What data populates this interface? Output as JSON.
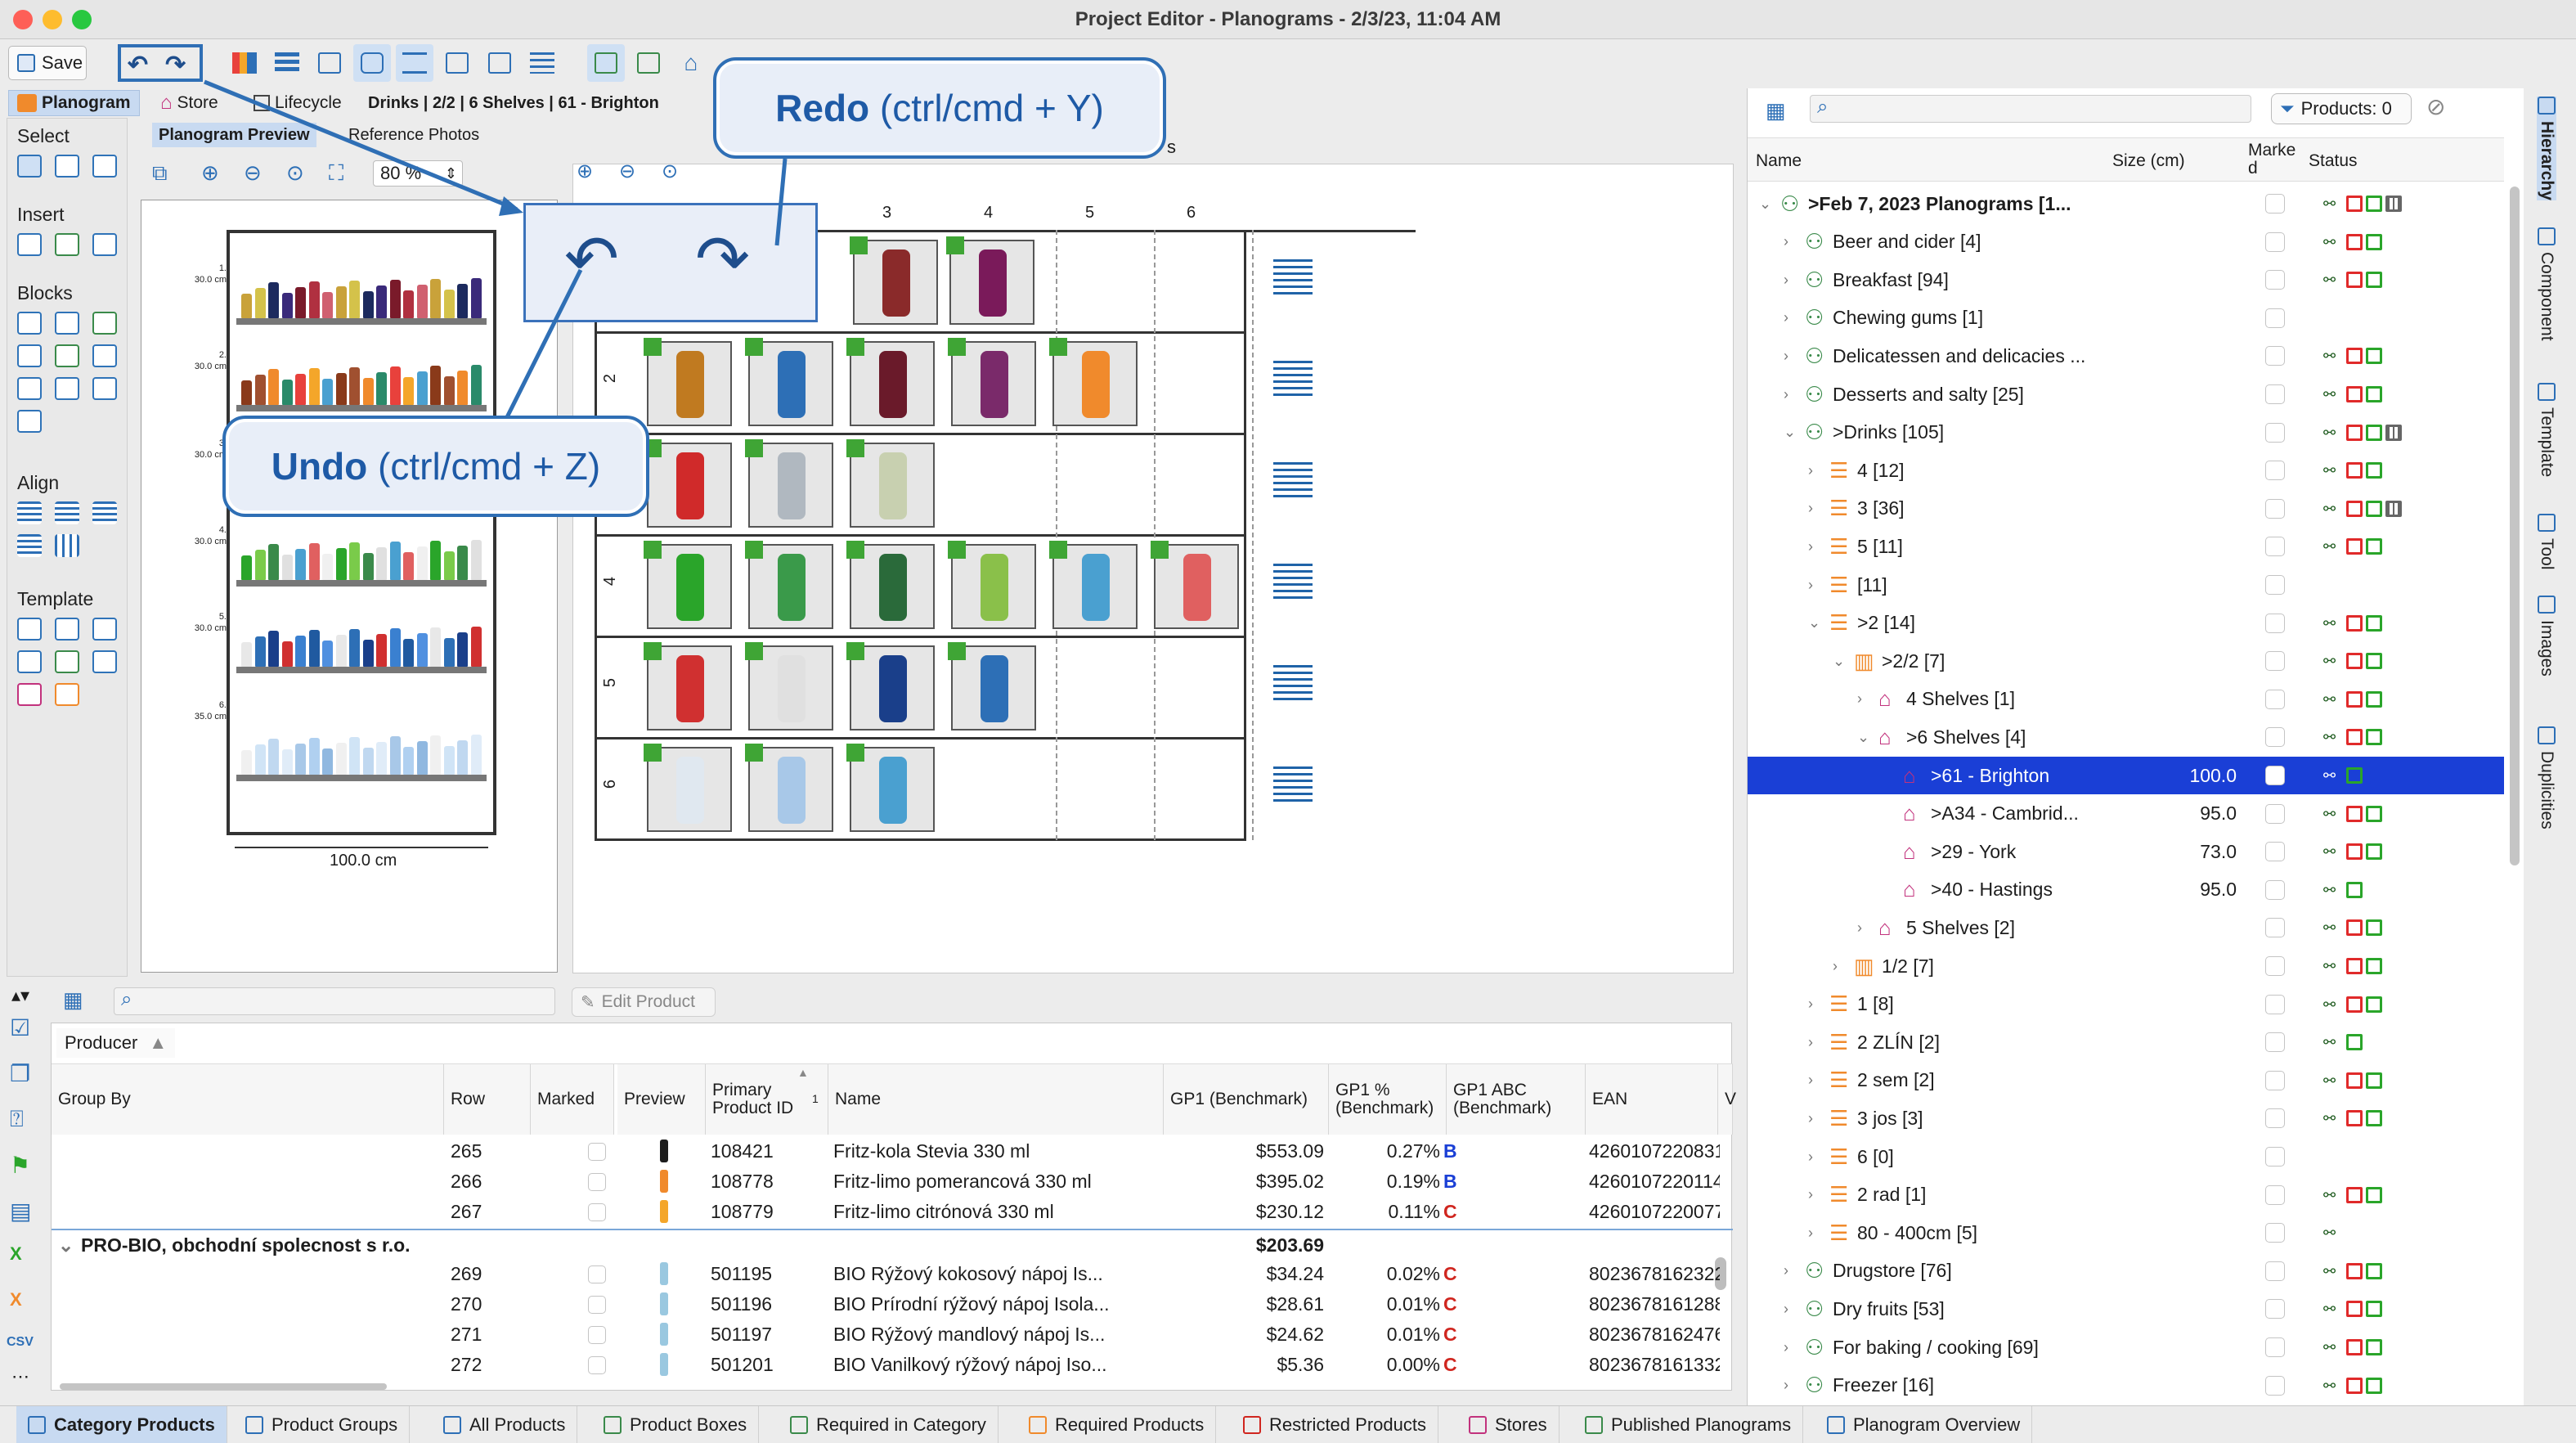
{
  "window": {
    "title": "Project Editor - Planograms - 2/3/23, 11:04 AM"
  },
  "toolbar": {
    "save_label": "Save"
  },
  "view_tabs": {
    "planogram": "Planogram",
    "store": "Store",
    "lifecycle": "Lifecycle",
    "breadcrumb": "Drinks | 2/2 | 6 Shelves | 61 - Brighton"
  },
  "preview_tabs": {
    "planogram_preview": "Planogram Preview",
    "reference_photos": "Reference Photos",
    "zoom": "80 %"
  },
  "palette": {
    "select": "Select",
    "insert": "Insert",
    "blocks": "Blocks",
    "align": "Align",
    "template": "Template"
  },
  "preview": {
    "shelf_labels": [
      {
        "num": "1.",
        "size": "30.0 cm"
      },
      {
        "num": "2.",
        "size": "30.0 cm"
      },
      {
        "num": "3.",
        "size": "30.0 cm"
      },
      {
        "num": "4.",
        "size": "30.0 cm"
      },
      {
        "num": "5.",
        "size": "30.0 cm"
      },
      {
        "num": "6.",
        "size": "35.0 cm"
      }
    ],
    "width_label": "100.0 cm"
  },
  "planogram": {
    "col_headers": [
      "3",
      "4",
      "5",
      "6"
    ],
    "row_labels": [
      "2",
      "3",
      "4",
      "5",
      "6"
    ],
    "side_text": "s"
  },
  "callouts": {
    "redo": {
      "bold": "Redo",
      "rest": " (ctrl/cmd + Y)"
    },
    "undo": {
      "bold": "Undo",
      "rest": " (ctrl/cmd + Z)"
    }
  },
  "hierarchy": {
    "products_button": "Products: 0",
    "columns": {
      "name": "Name",
      "size": "Size (cm)",
      "marked": "Marke d",
      "status": "Status"
    },
    "rows": [
      {
        "indent": 0,
        "arrow": "v",
        "icon": "tree-icon",
        "label": ">Feb 7, 2023 Planograms [1...",
        "size": "",
        "bold": true,
        "status": [
          "net",
          "red",
          "green",
          "grid"
        ]
      },
      {
        "indent": 1,
        "arrow": ">",
        "icon": "tree-icon",
        "label": "Beer and cider [4]",
        "size": "",
        "status": [
          "net",
          "red",
          "green"
        ]
      },
      {
        "indent": 1,
        "arrow": ">",
        "icon": "tree-icon",
        "label": "Breakfast [94]",
        "size": "",
        "status": [
          "net",
          "red",
          "green"
        ]
      },
      {
        "indent": 1,
        "arrow": ">",
        "icon": "tree-icon",
        "label": "Chewing gums [1]",
        "size": "",
        "status": []
      },
      {
        "indent": 1,
        "arrow": ">",
        "icon": "tree-icon",
        "label": "Delicatessen and delicacies ...",
        "size": "",
        "status": [
          "net",
          "red",
          "green"
        ]
      },
      {
        "indent": 1,
        "arrow": ">",
        "icon": "tree-icon",
        "label": "Desserts and salty [25]",
        "size": "",
        "status": [
          "net",
          "red",
          "green"
        ]
      },
      {
        "indent": 1,
        "arrow": "v",
        "icon": "tree-icon",
        "label": ">Drinks [105]",
        "size": "",
        "status": [
          "net",
          "red",
          "green",
          "grid"
        ]
      },
      {
        "indent": 2,
        "arrow": ">",
        "icon": "shelf-icon",
        "label": "4 [12]",
        "size": "",
        "status": [
          "net",
          "red",
          "green"
        ]
      },
      {
        "indent": 2,
        "arrow": ">",
        "icon": "shelf-icon",
        "label": "3 [36]",
        "size": "",
        "status": [
          "net",
          "red",
          "green",
          "grid"
        ]
      },
      {
        "indent": 2,
        "arrow": ">",
        "icon": "shelf-icon",
        "label": "5 [11]",
        "size": "",
        "status": [
          "net",
          "red",
          "green"
        ]
      },
      {
        "indent": 2,
        "arrow": ">",
        "icon": "shelf-icon",
        "label": "[11]",
        "size": "",
        "status": []
      },
      {
        "indent": 2,
        "arrow": "v",
        "icon": "shelf-icon",
        "label": ">2 [14]",
        "size": "",
        "status": [
          "net",
          "red",
          "green"
        ]
      },
      {
        "indent": 3,
        "arrow": "v",
        "icon": "store-icon",
        "label": ">2/2 [7]",
        "size": "",
        "status": [
          "net",
          "red",
          "green"
        ]
      },
      {
        "indent": 4,
        "arrow": ">",
        "icon": "house-icon",
        "label": "4 Shelves [1]",
        "size": "",
        "status": [
          "net",
          "red",
          "green"
        ]
      },
      {
        "indent": 4,
        "arrow": "v",
        "icon": "house-icon",
        "label": ">6 Shelves [4]",
        "size": "",
        "status": [
          "net",
          "red",
          "green"
        ]
      },
      {
        "indent": 5,
        "arrow": "",
        "icon": "house-icon",
        "label": ">61 - Brighton",
        "size": "100.0",
        "selected": true,
        "status": [
          "net",
          "green"
        ]
      },
      {
        "indent": 5,
        "arrow": "",
        "icon": "house-icon",
        "label": ">A34 - Cambrid...",
        "size": "95.0",
        "status": [
          "net",
          "red",
          "green"
        ]
      },
      {
        "indent": 5,
        "arrow": "",
        "icon": "house-icon",
        "label": ">29 - York",
        "size": "73.0",
        "status": [
          "net",
          "red",
          "green"
        ]
      },
      {
        "indent": 5,
        "arrow": "",
        "icon": "house-icon",
        "label": ">40 - Hastings",
        "size": "95.0",
        "status": [
          "net",
          "green"
        ]
      },
      {
        "indent": 4,
        "arrow": ">",
        "icon": "house-icon",
        "label": "5 Shelves [2]",
        "size": "",
        "status": [
          "net",
          "red",
          "green"
        ]
      },
      {
        "indent": 3,
        "arrow": ">",
        "icon": "store-icon",
        "label": "1/2 [7]",
        "size": "",
        "status": [
          "net",
          "red",
          "green"
        ]
      },
      {
        "indent": 2,
        "arrow": ">",
        "icon": "shelf-icon",
        "label": "1 [8]",
        "size": "",
        "status": [
          "net",
          "red",
          "green"
        ]
      },
      {
        "indent": 2,
        "arrow": ">",
        "icon": "shelf-icon",
        "label": "2 ZLÍN [2]",
        "size": "",
        "status": [
          "net",
          "green"
        ]
      },
      {
        "indent": 2,
        "arrow": ">",
        "icon": "shelf-icon",
        "label": "2 sem [2]",
        "size": "",
        "status": [
          "net",
          "red",
          "green"
        ]
      },
      {
        "indent": 2,
        "arrow": ">",
        "icon": "shelf-icon",
        "label": "3 jos [3]",
        "size": "",
        "status": [
          "net",
          "red",
          "green"
        ]
      },
      {
        "indent": 2,
        "arrow": ">",
        "icon": "shelf-icon",
        "label": "6 [0]",
        "size": "",
        "status": []
      },
      {
        "indent": 2,
        "arrow": ">",
        "icon": "shelf-icon",
        "label": "2 rad [1]",
        "size": "",
        "status": [
          "net",
          "red",
          "green"
        ]
      },
      {
        "indent": 2,
        "arrow": ">",
        "icon": "shelf-icon",
        "label": "80 - 400cm [5]",
        "size": "",
        "status": [
          "net"
        ]
      },
      {
        "indent": 1,
        "arrow": ">",
        "icon": "tree-icon",
        "label": "Drugstore [76]",
        "size": "",
        "status": [
          "net",
          "red",
          "green"
        ]
      },
      {
        "indent": 1,
        "arrow": ">",
        "icon": "tree-icon",
        "label": "Dry fruits [53]",
        "size": "",
        "status": [
          "net",
          "red",
          "green"
        ]
      },
      {
        "indent": 1,
        "arrow": ">",
        "icon": "tree-icon",
        "label": "For baking / cooking [69]",
        "size": "",
        "status": [
          "net",
          "red",
          "green"
        ]
      },
      {
        "indent": 1,
        "arrow": ">",
        "icon": "tree-icon",
        "label": "Freezer [16]",
        "size": "",
        "status": [
          "net",
          "red",
          "green"
        ]
      }
    ]
  },
  "side_tabs": [
    "Hierarchy",
    "Component",
    "Template",
    "Tool",
    "Images",
    "Duplicities"
  ],
  "product_table": {
    "edit_button": "Edit Product",
    "group_field": "Producer",
    "headers": [
      "Group By",
      "Row",
      "Marked",
      "Preview",
      "Primary Product ID",
      "Name",
      "GP1 (Benchmark)",
      "GP1 % (Benchmark)",
      "GP1 ABC (Benchmark)",
      "EAN",
      "V"
    ],
    "sort_index": "1",
    "group_row": {
      "label": "PRO-BIO, obchodní spolecnost s r.o.",
      "total": "$203.69"
    },
    "rows_a": [
      {
        "row": "265",
        "id": "108421",
        "name": "Fritz-kola Stevia 330 ml",
        "gp1": "$553.09",
        "pct": "0.27%",
        "abc": "B",
        "ean": "4260107220831"
      },
      {
        "row": "266",
        "id": "108778",
        "name": "Fritz-limo pomerancová 330 ml",
        "gp1": "$395.02",
        "pct": "0.19%",
        "abc": "B",
        "ean": "4260107220114"
      },
      {
        "row": "267",
        "id": "108779",
        "name": "Fritz-limo citrónová 330 ml",
        "gp1": "$230.12",
        "pct": "0.11%",
        "abc": "C",
        "ean": "4260107220077"
      }
    ],
    "rows_b": [
      {
        "row": "269",
        "id": "501195",
        "name": "BIO Rýžový kokosový nápoj Is...",
        "gp1": "$34.24",
        "pct": "0.02%",
        "abc": "C",
        "ean": "8023678162322"
      },
      {
        "row": "270",
        "id": "501196",
        "name": "BIO Prírodní rýžový nápoj Isola...",
        "gp1": "$28.61",
        "pct": "0.01%",
        "abc": "C",
        "ean": "8023678161288"
      },
      {
        "row": "271",
        "id": "501197",
        "name": "BIO Rýžový mandlový nápoj Is...",
        "gp1": "$24.62",
        "pct": "0.01%",
        "abc": "C",
        "ean": "8023678162476"
      },
      {
        "row": "272",
        "id": "501201",
        "name": "BIO Vanilkový rýžový nápoj Iso...",
        "gp1": "$5.36",
        "pct": "0.00%",
        "abc": "C",
        "ean": "8023678161332"
      }
    ]
  },
  "bottom_tabs": [
    "Category Products",
    "Product Groups",
    "All Products",
    "Product Boxes",
    "Required in Category",
    "Required Products",
    "Restricted Products",
    "Stores",
    "Published Planograms",
    "Planogram Overview"
  ],
  "colors": {
    "accent": "#2f6fb5",
    "selection": "#1a3fd6",
    "status_red": "#e02a2a",
    "status_green": "#2aa52a",
    "grade_b": "#1a3fd6",
    "grade_c": "#d0261f"
  }
}
